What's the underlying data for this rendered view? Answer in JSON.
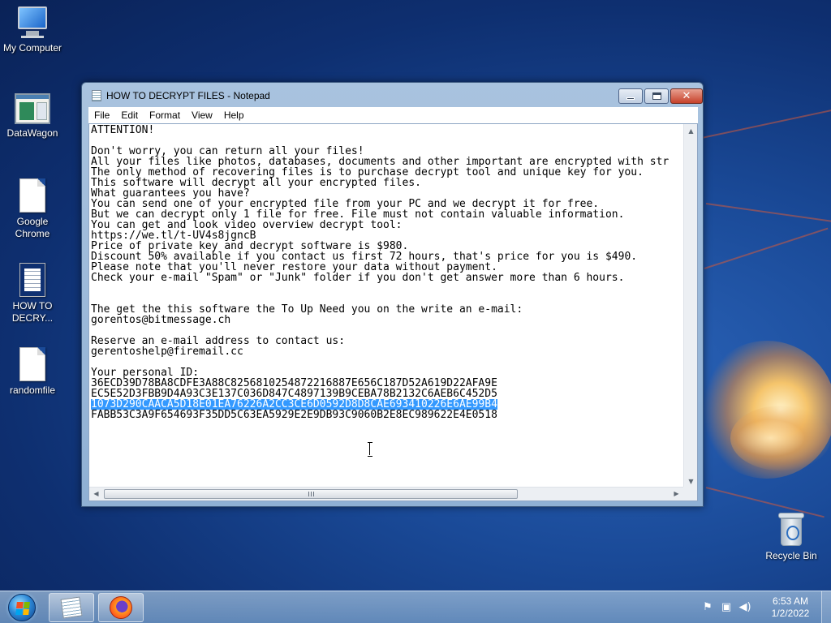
{
  "desktop": {
    "icons": [
      {
        "label": "My Computer"
      },
      {
        "label": "DataWagon"
      },
      {
        "label": "Google Chrome"
      },
      {
        "label": "HOW TO DECRY..."
      },
      {
        "label": "randomfile"
      },
      {
        "label": "Recycle Bin"
      }
    ]
  },
  "window": {
    "title": "HOW TO DECRYPT FILES - Notepad",
    "close_glyph": "✕",
    "menu": [
      "File",
      "Edit",
      "Format",
      "View",
      "Help"
    ]
  },
  "document": {
    "lines": [
      "ATTENTION!",
      "",
      "Don't worry, you can return all your files!",
      "All your files like photos, databases, documents and other important are encrypted with str",
      "The only method of recovering files is to purchase decrypt tool and unique key for you.",
      "This software will decrypt all your encrypted files.",
      "What guarantees you have?",
      "You can send one of your encrypted file from your PC and we decrypt it for free.",
      "But we can decrypt only 1 file for free. File must not contain valuable information.",
      "You can get and look video overview decrypt tool:",
      "https://we.tl/t-UV4s8jgncB",
      "Price of private key and decrypt software is $980.",
      "Discount 50% available if you contact us first 72 hours, that's price for you is $490.",
      "Please note that you'll never restore your data without payment.",
      "Check your e-mail \"Spam\" or \"Junk\" folder if you don't get answer more than 6 hours.",
      "",
      "",
      "The get the this software the To Up Need you on the write an e-mail:",
      "gorentos@bitmessage.ch",
      "",
      "Reserve an e-mail address to contact us:",
      "gerentoshelp@firemail.cc",
      "",
      "Your personal ID:",
      "36ECD39D78BA8CDFE3A88C8256810254872216887E656C187D52A619D22AFA9E",
      "EC5E52D3FBB9D4A93C3E137C036D847C4897139B9CEBA78B2132C6AEB6C452D5",
      "1073D290CAACA5D18E01EA76226A2CC3CE6D0592D8D8CAE693410226E6AE99B4",
      "FABB53C3A9F654693F35DD5C63EA5929E2E9DB93C9060B2E8EC989622E4E0518"
    ],
    "selected_line_index": 26
  },
  "taskbar": {
    "pinned": [
      "notepad-icon",
      "firefox-icon"
    ],
    "tray_icons": [
      "action-center-flag-icon",
      "network-icon",
      "volume-icon"
    ],
    "time": "6:53 AM",
    "date": "1/2/2022"
  }
}
